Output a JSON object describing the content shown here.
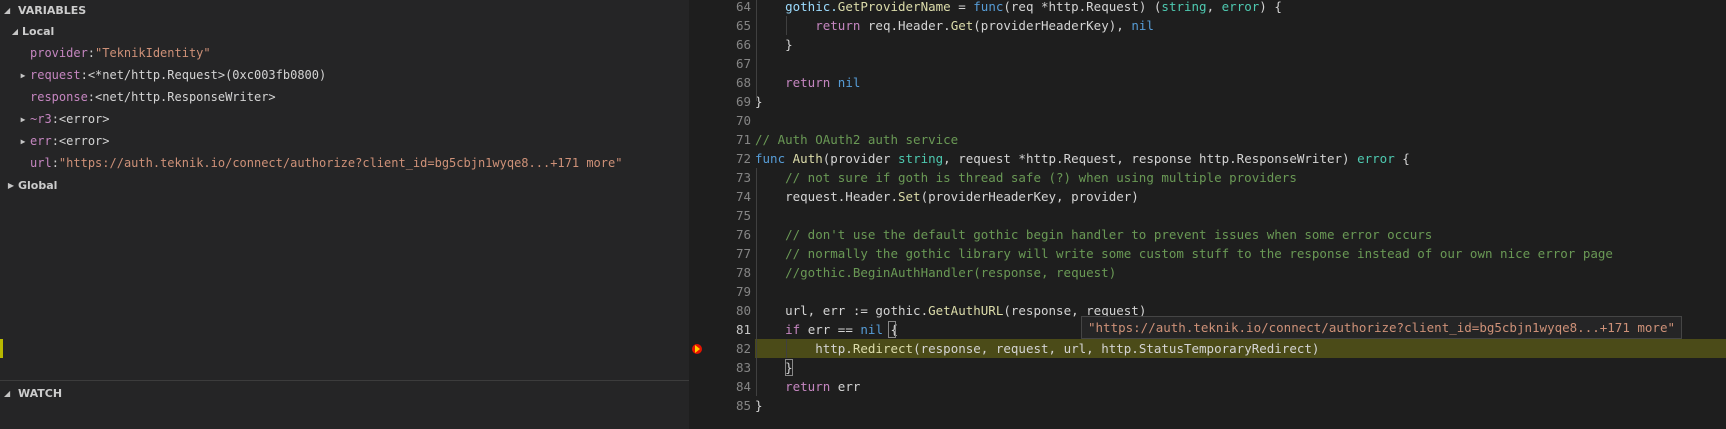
{
  "variables_panel": {
    "title": "VARIABLES",
    "local_label": "Local",
    "global_label": "Global",
    "locals": [
      {
        "name": "provider",
        "value": "\"TeknikIdentity\"",
        "kind": "string",
        "expandable": false
      },
      {
        "name": "request",
        "value": "<*net/http.Request>(0xc003fb0800)",
        "kind": "other",
        "expandable": true
      },
      {
        "name": "response",
        "value": "<net/http.ResponseWriter>",
        "kind": "other",
        "expandable": false
      },
      {
        "name": "~r3",
        "value": "<error>",
        "kind": "other",
        "expandable": true
      },
      {
        "name": "err",
        "value": "<error>",
        "kind": "other",
        "expandable": true
      },
      {
        "name": "url",
        "value": "\"https://auth.teknik.io/connect/authorize?client_id=bg5cbjn1wyqe8...+171 more\"",
        "kind": "string",
        "expandable": false
      }
    ]
  },
  "watch_panel": {
    "title": "WATCH"
  },
  "editor": {
    "current_line": 82,
    "hover_value": "\"https://auth.teknik.io/connect/authorize?client_id=bg5cbjn1wyqe8...+171 more\"",
    "lines": [
      {
        "n": "64"
      },
      {
        "n": "65"
      },
      {
        "n": "66"
      },
      {
        "n": "67"
      },
      {
        "n": "68"
      },
      {
        "n": "69"
      },
      {
        "n": "70"
      },
      {
        "n": "71"
      },
      {
        "n": "72"
      },
      {
        "n": "73"
      },
      {
        "n": "74"
      },
      {
        "n": "75"
      },
      {
        "n": "76"
      },
      {
        "n": "77"
      },
      {
        "n": "78"
      },
      {
        "n": "79"
      },
      {
        "n": "80"
      },
      {
        "n": "81"
      },
      {
        "n": "82"
      },
      {
        "n": "83"
      },
      {
        "n": "84"
      },
      {
        "n": "85"
      }
    ],
    "code": {
      "l64a": "    gothic.",
      "l64b": "GetProviderName",
      "l64c": " = ",
      "l64d": "func",
      "l64e": "(req *http.Request) (",
      "l64f": "string",
      "l64g": ", ",
      "l64h": "error",
      "l64i": ") {",
      "l65a": "        ",
      "l65b": "return",
      "l65c": " req.Header.",
      "l65d": "Get",
      "l65e": "(providerHeaderKey), ",
      "l65f": "nil",
      "l66": "    }",
      "l68a": "    ",
      "l68b": "return",
      "l68c": " ",
      "l68d": "nil",
      "l69": "}",
      "l71": "// Auth OAuth2 auth service",
      "l72a": "func",
      "l72b": " ",
      "l72c": "Auth",
      "l72d": "(provider ",
      "l72e": "string",
      "l72f": ", request *http.Request, response http.ResponseWriter) ",
      "l72g": "error",
      "l72h": " {",
      "l73": "    // not sure if goth is thread safe (?) when using multiple providers",
      "l74a": "    request.Header.",
      "l74b": "Set",
      "l74c": "(providerHeaderKey, provider)",
      "l76": "    // don't use the default gothic begin handler to prevent issues when some error occurs",
      "l77": "    // normally the gothic library will write some custom stuff to the response instead of our own nice error page",
      "l78": "    //gothic.BeginAuthHandler(response, request)",
      "l80a": "    url, err := gothic.",
      "l80b": "GetAuthURL",
      "l80c": "(response, request)",
      "l81a": "    ",
      "l81b": "if",
      "l81c": " err == ",
      "l81d": "nil",
      "l81e": " {",
      "l82a": "        http.",
      "l82b": "Redirect",
      "l82c": "(response, request, url, http.StatusTemporaryRedirect)",
      "l83": "    }",
      "l84a": "    ",
      "l84b": "return",
      "l84c": " err",
      "l85": "}"
    }
  },
  "colors": {
    "breakpoint": "#e51400",
    "current_line_bg": "#4b4b18",
    "string": "#ce9178",
    "keyword": "#569cd6"
  }
}
